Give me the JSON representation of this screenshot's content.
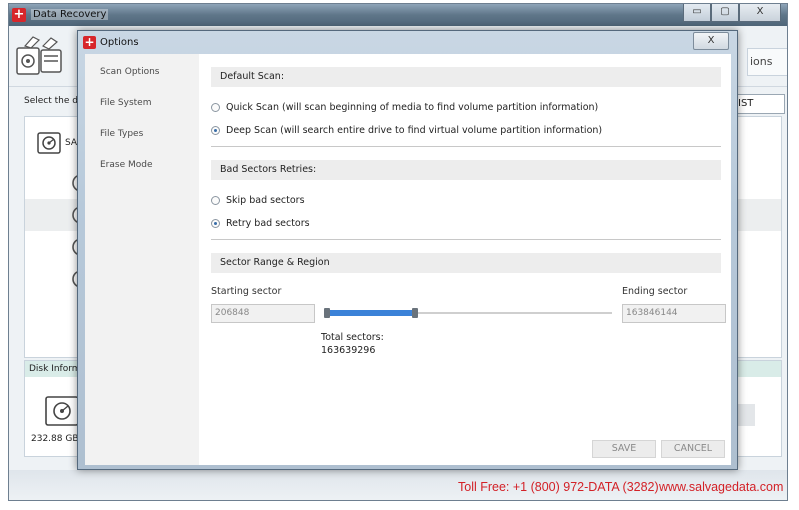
{
  "app": {
    "title": "Data Recovery",
    "options_tab_label": "ions",
    "select_label": "Select the d",
    "list_tab_label": "IST",
    "drive_row_label": "SA",
    "disk_info_label": "Disk Inform",
    "disk_size": "232.88 GB",
    "footer": {
      "toll_free": "Toll Free: +1 (800) 972-DATA (3282)",
      "website": "www.salvagedata.com"
    },
    "window_buttons": {
      "minimize": "▭",
      "maximize": "▢",
      "close": "X"
    }
  },
  "dialog": {
    "title": "Options",
    "close_label": "X",
    "nav": [
      "Scan Options",
      "File System",
      "File Types",
      "Erase Mode"
    ],
    "default_scan": {
      "header": "Default Scan:",
      "options": [
        {
          "label": "Quick Scan (will scan beginning of media to find volume partition information)",
          "selected": false
        },
        {
          "label": "Deep Scan (will search entire drive to find virtual volume partition information)",
          "selected": true
        }
      ]
    },
    "bad_sectors": {
      "header": "Bad Sectors Retries:",
      "options": [
        {
          "label": "Skip bad sectors",
          "selected": false
        },
        {
          "label": "Retry bad sectors",
          "selected": true
        }
      ]
    },
    "sector_range": {
      "header": "Sector Range & Region",
      "starting_label": "Starting sector",
      "starting_value": "206848",
      "ending_label": "Ending sector",
      "ending_value": "163846144",
      "total_label": "Total sectors:",
      "total_value": "163639296"
    },
    "buttons": {
      "save": "SAVE",
      "cancel": "CANCEL"
    }
  },
  "colors": {
    "brand_red": "#d32127",
    "slider_blue": "#3b82d8",
    "nav_bg": "#f2f2f2"
  }
}
